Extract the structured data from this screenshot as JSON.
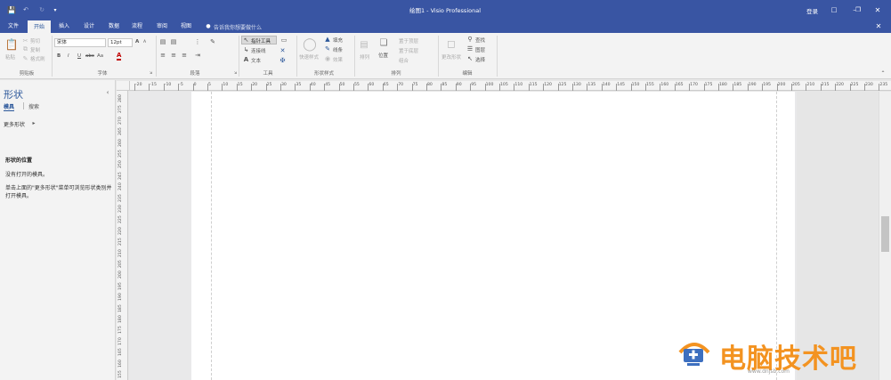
{
  "titlebar": {
    "title": "绘图1 - Visio Professional",
    "login": "登录",
    "window_buttons": [
      "minimize-icon",
      "restore-icon",
      "close-icon"
    ]
  },
  "quick_access": [
    "save-icon",
    "undo-icon",
    "redo-icon",
    "customize-icon"
  ],
  "tabs": [
    "文件",
    "开始",
    "插入",
    "设计",
    "数据",
    "流程",
    "审阅",
    "视图"
  ],
  "active_tab": "开始",
  "tell_me": "告诉我你想要做什么",
  "ribbon": {
    "clipboard": {
      "paste": "粘贴",
      "cut": "剪切",
      "copy": "复制",
      "format_painter": "格式刷",
      "label": "剪贴板"
    },
    "font": {
      "font_name": "宋体",
      "font_size": "12pt",
      "bold": "B",
      "italic": "I",
      "underline": "U",
      "strike": "abc",
      "case": "Aa",
      "grow": "A",
      "shrink": "A",
      "color": "A",
      "label": "字体"
    },
    "paragraph": {
      "label": "段落"
    },
    "tools": {
      "pointer": "指针工具",
      "connector": "连接线",
      "text": "文本",
      "label": "工具"
    },
    "shape_styles": {
      "quick_styles": "快速样式",
      "fill": "填充",
      "line": "线条",
      "effects": "效果",
      "label": "形状样式"
    },
    "arrange": {
      "align": "排列",
      "position": "位置",
      "bring_front": "置于顶层",
      "send_back": "置于底层",
      "group": "组合",
      "label": "排列"
    },
    "editing": {
      "change_shape": "更改形状",
      "find": "查找",
      "layers": "图层",
      "select": "选择",
      "label": "编辑"
    }
  },
  "shapes_pane": {
    "title": "形状",
    "tab_stencils": "模具",
    "tab_search": "搜索",
    "more_shapes": "更多形状",
    "section_title": "形状的位置",
    "no_stencils": "没有打开的模具。",
    "hint": "单击上面的\"更多形状\"菜单可浏览形状类别并打开模具。"
  },
  "hruler_ticks": [
    "-20",
    "-15",
    "-10",
    "-5",
    "0",
    "5",
    "10",
    "15",
    "20",
    "25",
    "30",
    "35",
    "40",
    "45",
    "50",
    "55",
    "60",
    "65",
    "70",
    "75",
    "80",
    "85",
    "90",
    "95",
    "100",
    "105",
    "110",
    "115",
    "120",
    "125",
    "130",
    "135",
    "140",
    "145",
    "150",
    "155",
    "160",
    "165",
    "170",
    "175",
    "180",
    "185",
    "190",
    "195",
    "200",
    "205",
    "210",
    "215",
    "220",
    "225",
    "230",
    "235"
  ],
  "vruler_ticks": [
    "280",
    "275",
    "270",
    "265",
    "260",
    "255",
    "250",
    "245",
    "240",
    "235",
    "230",
    "225",
    "220",
    "215",
    "210",
    "205",
    "200",
    "195",
    "190",
    "185",
    "180",
    "175",
    "170",
    "165",
    "160",
    "155"
  ],
  "watermark": {
    "text": "电脑技术吧",
    "sub": "www.dnjsb.com"
  }
}
